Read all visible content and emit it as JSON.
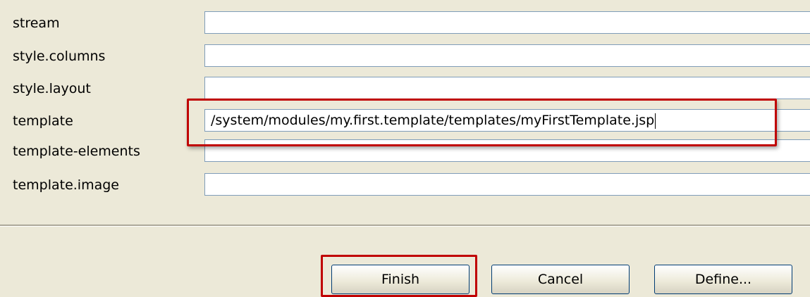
{
  "properties": [
    {
      "label": "stream",
      "value": ""
    },
    {
      "label": "style.columns",
      "value": ""
    },
    {
      "label": "style.layout",
      "value": ""
    },
    {
      "label": "template",
      "value": "/system/modules/my.first.template/templates/myFirstTemplate.jsp"
    },
    {
      "label": "template-elements",
      "value": ""
    },
    {
      "label": "template.image",
      "value": ""
    }
  ],
  "buttons": {
    "finish": "Finish",
    "cancel": "Cancel",
    "define": "Define..."
  },
  "colors": {
    "background": "#ece9d8",
    "highlight": "#c00000",
    "field_border": "#7f9db9"
  }
}
